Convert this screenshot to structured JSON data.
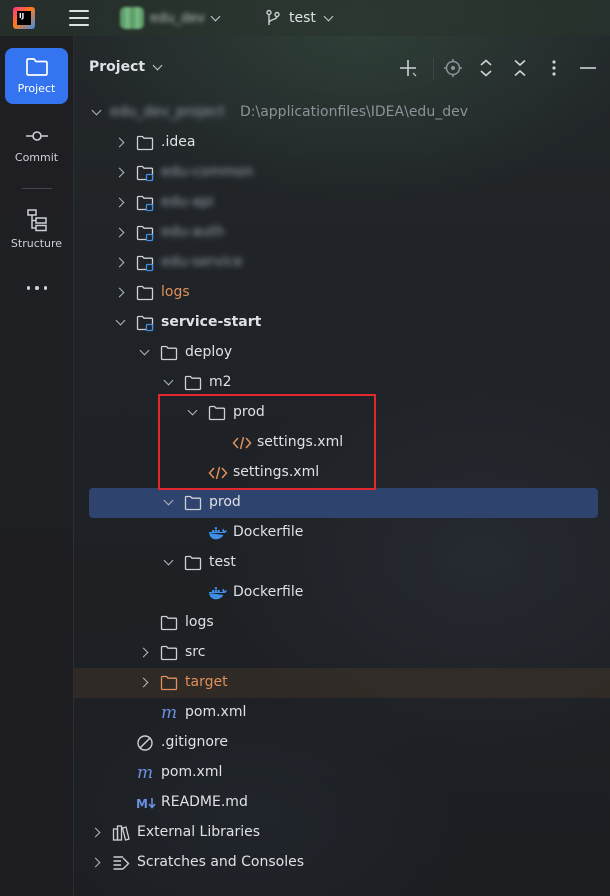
{
  "titlebar": {
    "app_logo_text": "IJ",
    "project_name": "edu_dev",
    "branch": "test"
  },
  "toolstrip": {
    "items": [
      {
        "label": "Project",
        "icon": "folder-icon"
      },
      {
        "label": "Commit",
        "icon": "commit-icon"
      },
      {
        "label": "Structure",
        "icon": "structure-icon"
      }
    ]
  },
  "panel": {
    "title": "Project",
    "actions": [
      "add-icon",
      "locate-icon",
      "expand-all-icon",
      "collapse-all-icon",
      "more-icon",
      "hide-icon"
    ]
  },
  "tree": {
    "root_name": "edu_dev_project",
    "root_path": "D:\\applicationfiles\\IDEA\\edu_dev",
    "items": [
      {
        "label": ".idea"
      },
      {
        "label": "edu-common"
      },
      {
        "label": "edu-api"
      },
      {
        "label": "edu-auth"
      },
      {
        "label": "edu-service"
      },
      {
        "label": "logs"
      },
      {
        "label": "service-start"
      },
      {
        "label": "deploy"
      },
      {
        "label": "m2"
      },
      {
        "label": "prod"
      },
      {
        "label": "settings.xml"
      },
      {
        "label": "settings.xml"
      },
      {
        "label": "prod"
      },
      {
        "label": "Dockerfile"
      },
      {
        "label": "test"
      },
      {
        "label": "Dockerfile"
      },
      {
        "label": "logs"
      },
      {
        "label": "src"
      },
      {
        "label": "target"
      },
      {
        "label": "pom.xml"
      },
      {
        "label": ".gitignore"
      },
      {
        "label": "pom.xml"
      },
      {
        "label": "README.md"
      },
      {
        "label": "External Libraries"
      },
      {
        "label": "Scratches and Consoles"
      }
    ]
  },
  "colors": {
    "accent": "#3574f0",
    "selection": "#2e436e",
    "excluded_text": "#e0915b",
    "highlight_border": "#e0282e",
    "xml_icon": "#e0915b",
    "docker_icon": "#3d8fe8"
  }
}
